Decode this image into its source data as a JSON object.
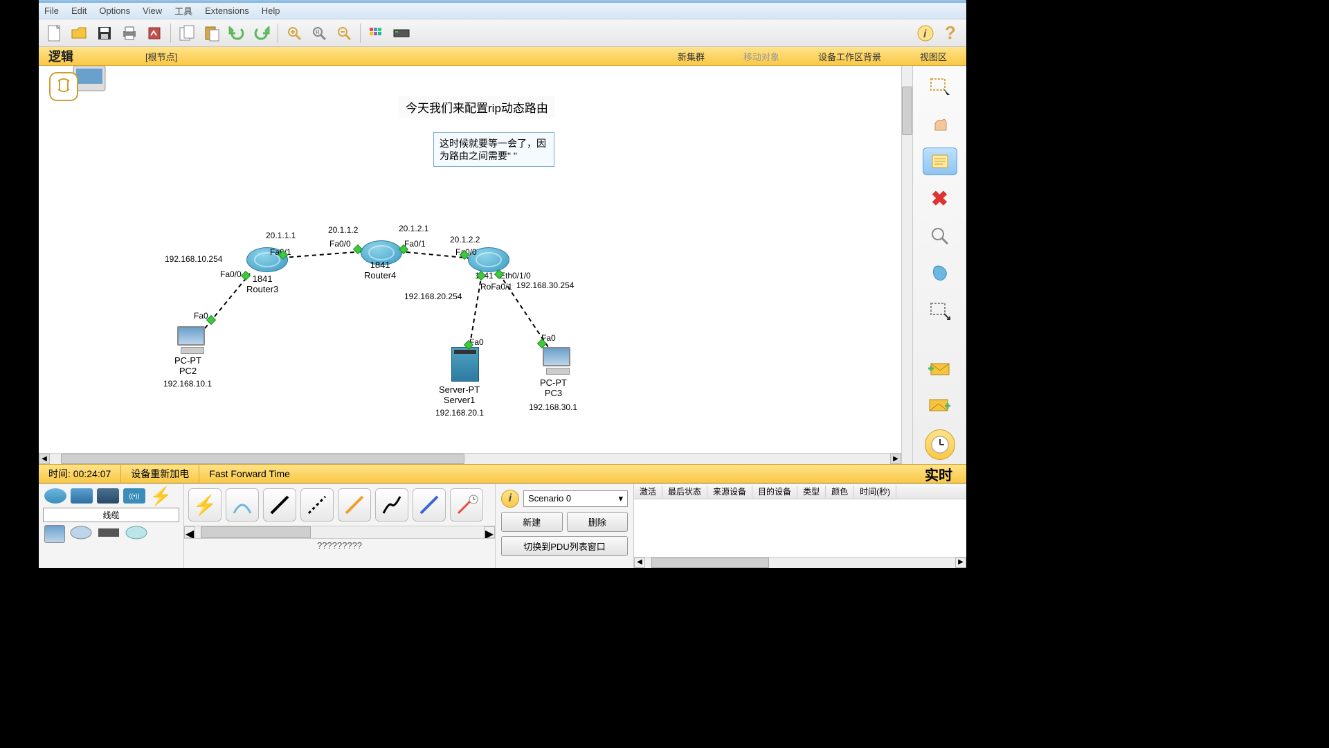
{
  "menu": {
    "file": "File",
    "edit": "Edit",
    "options": "Options",
    "view": "View",
    "tools": "工具",
    "extensions": "Extensions",
    "help": "Help"
  },
  "topbar": {
    "logic": "逻辑",
    "root": "[根节点]",
    "newcluster": "新集群",
    "moveobj": "移动对象",
    "setbg": "设备工作区背景",
    "viewport": "视图区"
  },
  "annotations": {
    "title": "今天我们来配置rip动态路由",
    "note": "这时候就要等一会了，因为路由之间需要\" \""
  },
  "devices": {
    "r3": {
      "model": "1841",
      "name": "Router3",
      "ifs": {
        "fa00": "Fa0/0",
        "fa01": "Fa0/1"
      },
      "ips": {
        "fa01": "20.1.1.1",
        "fa00": "192.168.10.254"
      }
    },
    "r4": {
      "model": "1841",
      "name": "Router4",
      "ifs": {
        "fa00": "Fa0/0",
        "fa01": "Fa0/1"
      },
      "ips": {
        "fa00": "20.1.1.2",
        "fa01": "20.1.2.1"
      }
    },
    "r5": {
      "model": "1841",
      "name": "Router5",
      "ifs": {
        "fa00": "Fa0/0",
        "fa01": "Fa0/1",
        "eth": "Eth0/1/0"
      },
      "ips": {
        "fa00": "20.1.2.2",
        "fa01": "192.168.20.254",
        "eth": "192.168.30.254"
      }
    },
    "pc2": {
      "type": "PC-PT",
      "name": "PC2",
      "ip": "192.168.10.1",
      "if": "Fa0"
    },
    "pc3": {
      "type": "PC-PT",
      "name": "PC3",
      "ip": "192.168.30.1",
      "if": "Fa0"
    },
    "srv1": {
      "type": "Server-PT",
      "name": "Server1",
      "ip": "192.168.20.1",
      "if": "Fa0"
    }
  },
  "timebar": {
    "time_label": "时间:",
    "time": "00:24:07",
    "reboot": "设备重新加电",
    "fft": "Fast Forward Time",
    "realtime": "实时"
  },
  "devpanel": {
    "cables": "线缆",
    "placeholder": "?????????"
  },
  "scenario": {
    "current": "Scenario 0",
    "new": "新建",
    "delete": "删除",
    "pdu": "切换到PDU列表窗口"
  },
  "evtable": {
    "fire": "激活",
    "last": "最后状态",
    "src": "来源设备",
    "dst": "目的设备",
    "type": "类型",
    "color": "颜色",
    "time": "时间(秒)"
  }
}
